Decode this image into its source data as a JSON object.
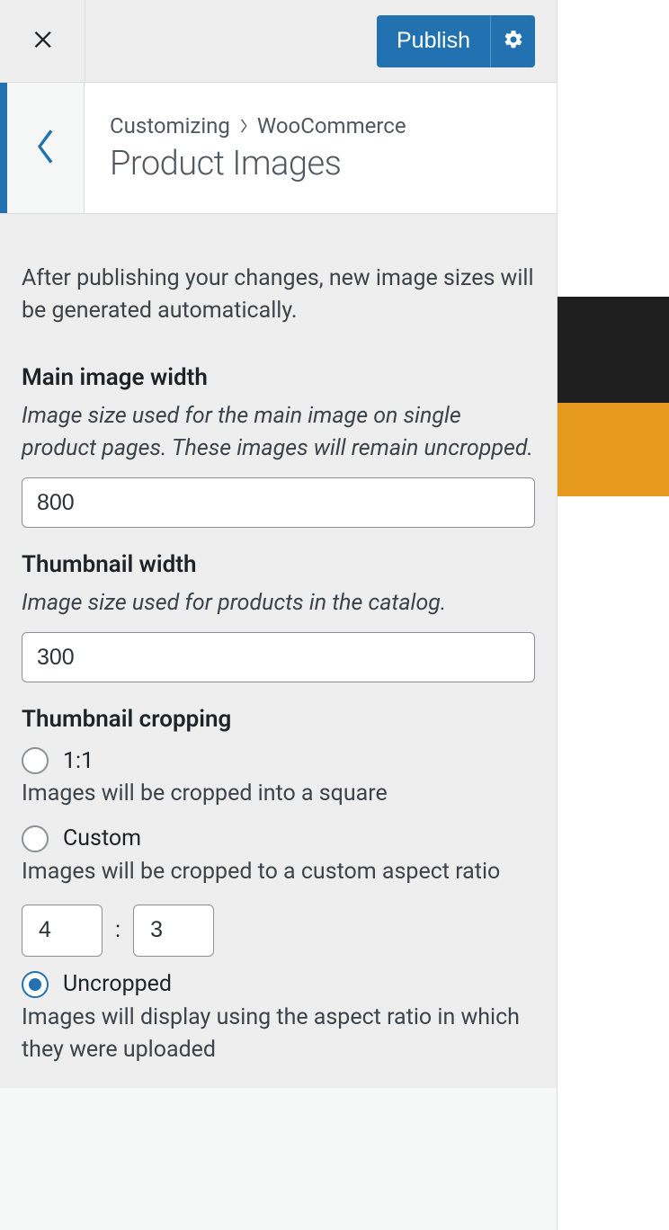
{
  "top": {
    "publish_label": "Publish"
  },
  "header": {
    "breadcrumb_root": "Customizing",
    "breadcrumb_parent": "WooCommerce",
    "page_title": "Product Images"
  },
  "intro": "After publishing your changes, new image sizes will be generated automatically.",
  "fields": {
    "main_width": {
      "label": "Main image width",
      "desc": "Image size used for the main image on single product pages. These images will remain uncropped.",
      "value": "800"
    },
    "thumb_width": {
      "label": "Thumbnail width",
      "desc": "Image size used for products in the catalog.",
      "value": "300"
    },
    "cropping": {
      "label": "Thumbnail cropping",
      "opt_1_1": {
        "label": "1:1",
        "desc": "Images will be cropped into a square"
      },
      "opt_custom": {
        "label": "Custom",
        "desc": "Images will be cropped to a custom aspect ratio",
        "ratio_a": "4",
        "ratio_sep": ":",
        "ratio_b": "3"
      },
      "opt_uncropped": {
        "label": "Uncropped",
        "desc": "Images will display using the aspect ratio in which they were uploaded"
      }
    }
  }
}
